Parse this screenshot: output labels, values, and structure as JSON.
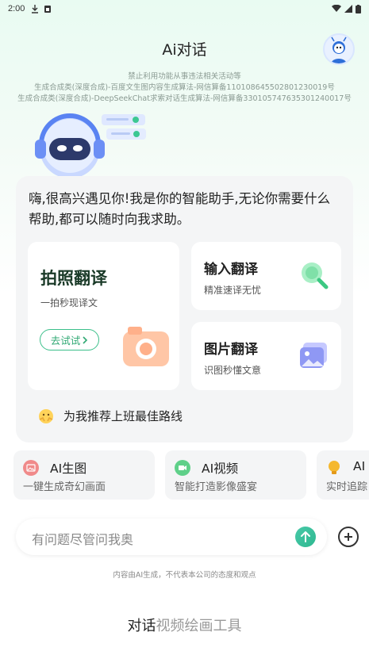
{
  "status_bar": {
    "time": "2:00"
  },
  "header": {
    "title": "Ai对话"
  },
  "notices": [
    "禁止利用功能从事违法相关活动等",
    "生成合成类(深度合成)-百度文生图内容生成算法-网信算备110108645502801230019号",
    "生成合成类(深度合成)-DeepSeekChat求索对话生成算法-网信算备330105747635301240017号"
  ],
  "greeting": "嗨,很高兴遇见你!我是你的智能助手,无论你需要什么帮助,都可以随时向我求助。",
  "cards": {
    "photo": {
      "title": "拍照翻译",
      "subtitle": "一拍秒现译文",
      "button": "去试试"
    },
    "input": {
      "title": "输入翻译",
      "subtitle": "精准速译无忧"
    },
    "image": {
      "title": "图片翻译",
      "subtitle": "识图秒懂文意"
    }
  },
  "recommend": {
    "text": "为我推荐上班最佳路线",
    "icon": "emoji-hands-icon"
  },
  "features": [
    {
      "label": "AI生图",
      "desc": "一键生成奇幻画面",
      "icon": "picture-icon",
      "color": "#f08a8a"
    },
    {
      "label": "AI视频",
      "desc": "智能打造影像盛宴",
      "icon": "video-icon",
      "color": "#5fd089"
    },
    {
      "label": "AI",
      "desc": "实时追踪",
      "icon": "bulb-icon",
      "color": "#f5b82e"
    }
  ],
  "input": {
    "placeholder": "有问题尽管问我奥"
  },
  "disclaimer": "内容由AI生成，不代表本公司的态度和观点",
  "nav": {
    "tabs": [
      "对话",
      "视频",
      "绘画",
      "工具"
    ],
    "active": "对话"
  },
  "colors": {
    "accent": "#2fa873",
    "card_bg": "#f4f5f6"
  }
}
